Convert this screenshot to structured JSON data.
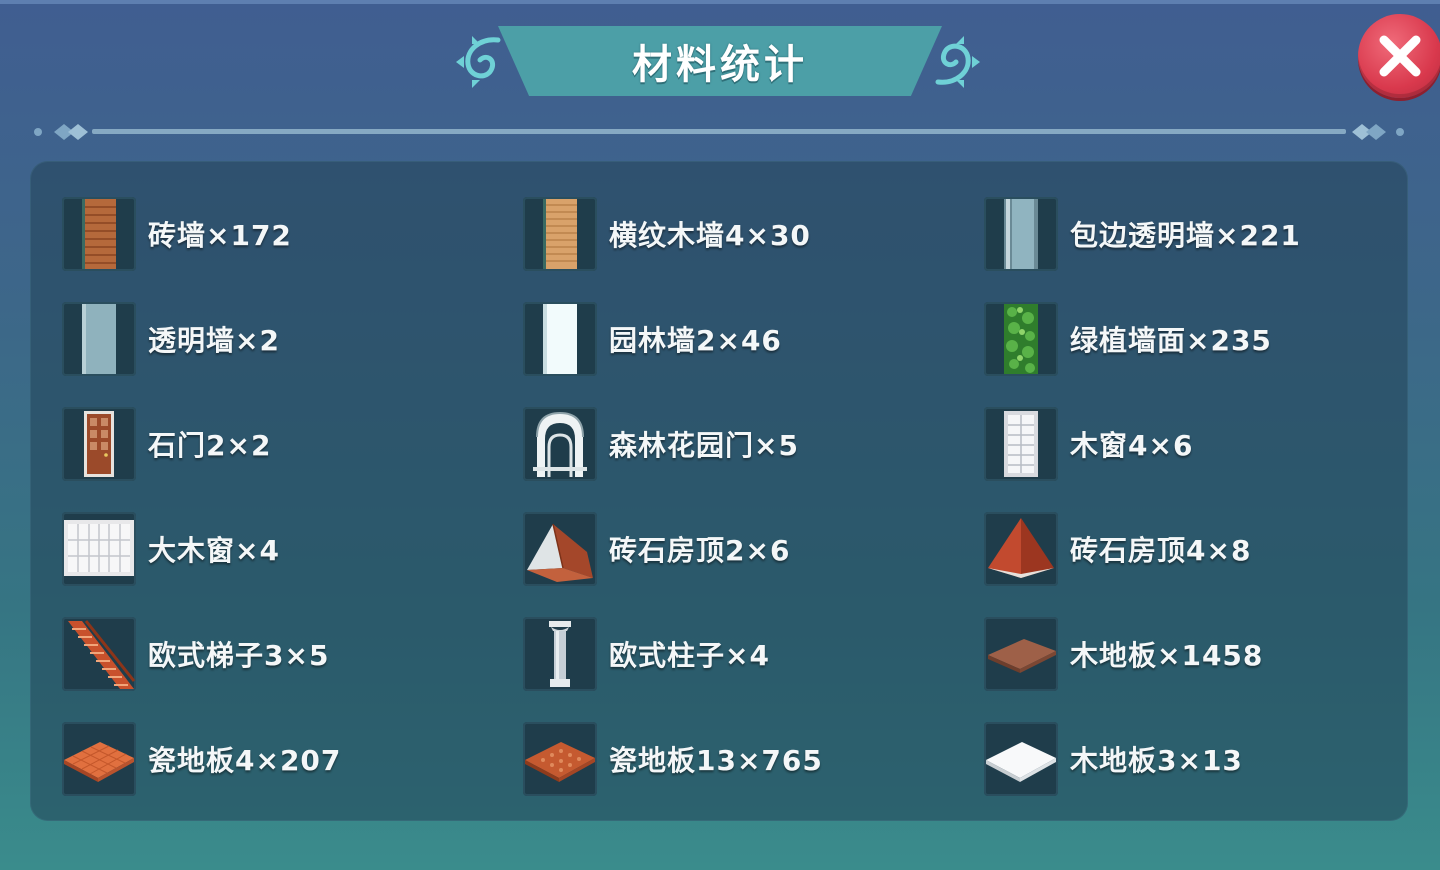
{
  "title": "材料统计",
  "close_icon": "close-x-icon",
  "colors": {
    "title_banner": "#4c9fa7",
    "close_button": "#d9394d",
    "panel": "#224458",
    "background_top": "#405e91",
    "background_bottom": "#3a8c8c"
  },
  "materials": [
    {
      "label": "砖墙×172",
      "icon": "brick-wall-icon"
    },
    {
      "label": "横纹木墙4×30",
      "icon": "wood-wall-icon"
    },
    {
      "label": "包边透明墙×221",
      "icon": "framed-glass-wall-icon"
    },
    {
      "label": "透明墙×2",
      "icon": "glass-wall-icon"
    },
    {
      "label": "园林墙2×46",
      "icon": "garden-wall-icon"
    },
    {
      "label": "绿植墙面×235",
      "icon": "green-plant-wall-icon"
    },
    {
      "label": "石门2×2",
      "icon": "stone-door-icon"
    },
    {
      "label": "森林花园门×5",
      "icon": "forest-garden-gate-icon"
    },
    {
      "label": "木窗4×6",
      "icon": "wood-window-icon"
    },
    {
      "label": "大木窗×4",
      "icon": "large-wood-window-icon"
    },
    {
      "label": "砖石房顶2×6",
      "icon": "brick-roof-gable-icon"
    },
    {
      "label": "砖石房顶4×8",
      "icon": "brick-roof-pyramid-icon"
    },
    {
      "label": "欧式梯子3×5",
      "icon": "european-stairs-icon"
    },
    {
      "label": "欧式柱子×4",
      "icon": "european-column-icon"
    },
    {
      "label": "木地板×1458",
      "icon": "wood-floor-icon"
    },
    {
      "label": "瓷地板4×207",
      "icon": "tile-floor-icon"
    },
    {
      "label": "瓷地板13×765",
      "icon": "tile-floor-grid-icon"
    },
    {
      "label": "木地板3×13",
      "icon": "white-floor-icon"
    }
  ]
}
